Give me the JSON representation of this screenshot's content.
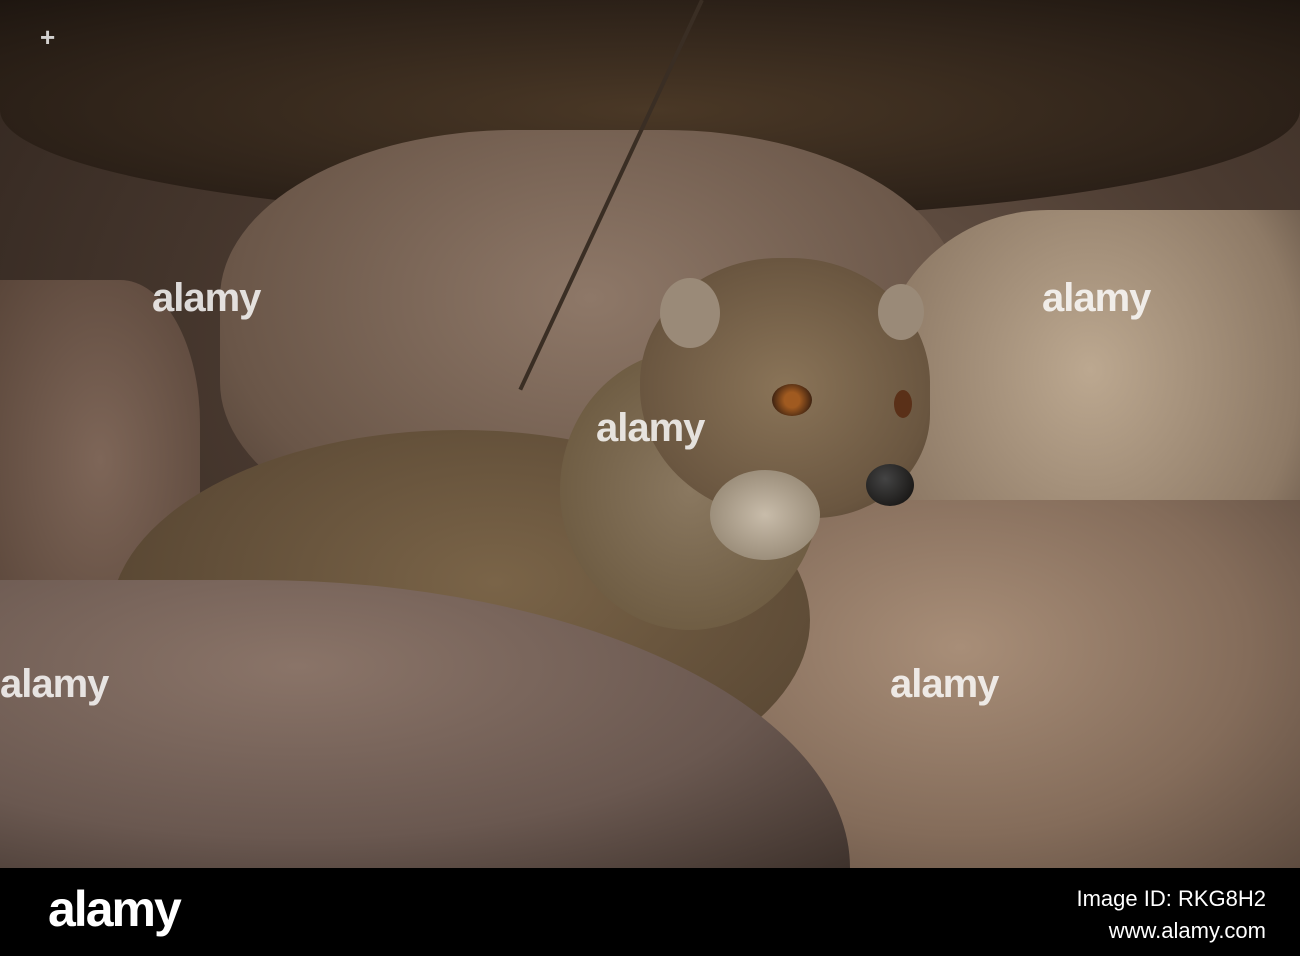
{
  "photo": {
    "subject": "mongoose",
    "watermark": "alamy"
  },
  "footer": {
    "logo": "alamy",
    "image_id": "Image ID: RKG8H2",
    "site": "www.alamy.com"
  },
  "colors": {
    "fur": "#7a6448",
    "rock": "#9a806c",
    "background": "#2a201a"
  }
}
